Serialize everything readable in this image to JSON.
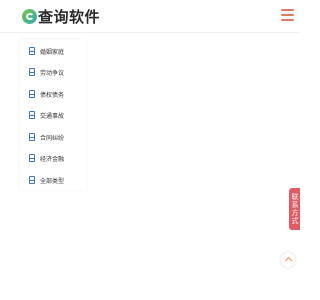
{
  "header": {
    "logo_text": "查询软件"
  },
  "categories": [
    {
      "label": "婚姻家庭",
      "icon": "document-icon"
    },
    {
      "label": "劳动争议",
      "icon": "document-icon"
    },
    {
      "label": "债权债务",
      "icon": "document-icon"
    },
    {
      "label": "交通事故",
      "icon": "document-icon"
    },
    {
      "label": "合同纠纷",
      "icon": "document-icon"
    },
    {
      "label": "经济金融",
      "icon": "document-icon"
    },
    {
      "label": "全部类型",
      "icon": "document-icon"
    }
  ],
  "contact_tab": {
    "label": "联系方式"
  },
  "colors": {
    "accent": "#e07a5f",
    "contact_bg": "#e15b64",
    "icon_blue": "#3c76c9",
    "logo_green": "#7ac943"
  }
}
